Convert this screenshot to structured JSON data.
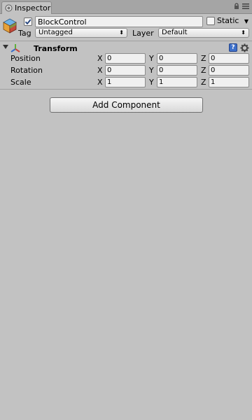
{
  "tab": {
    "label": "Inspector"
  },
  "object": {
    "name": "BlockControl",
    "active": true,
    "static_label": "Static",
    "static_checked": false,
    "tag_label": "Tag",
    "tag_value": "Untagged",
    "layer_label": "Layer",
    "layer_value": "Default"
  },
  "transform": {
    "title": "Transform",
    "help_label": "?",
    "rows": [
      {
        "label": "Position",
        "x": "0",
        "y": "0",
        "z": "0"
      },
      {
        "label": "Rotation",
        "x": "0",
        "y": "0",
        "z": "0"
      },
      {
        "label": "Scale",
        "x": "1",
        "y": "1",
        "z": "1"
      }
    ],
    "axis_labels": {
      "x": "X",
      "y": "Y",
      "z": "Z"
    }
  },
  "actions": {
    "add_component": "Add Component"
  },
  "colors": {
    "panel_bg": "#c2c2c2",
    "tabstrip_bg": "#a5a5a5",
    "help_blue": "#3d6fc9"
  },
  "icons": [
    "inspector-icon",
    "lock-icon",
    "menu-icon",
    "gameobject-cube-icon",
    "checkmark-icon",
    "dropdown-arrow-icon",
    "foldout-arrow-icon",
    "transform-icon",
    "help-icon",
    "gear-icon"
  ]
}
